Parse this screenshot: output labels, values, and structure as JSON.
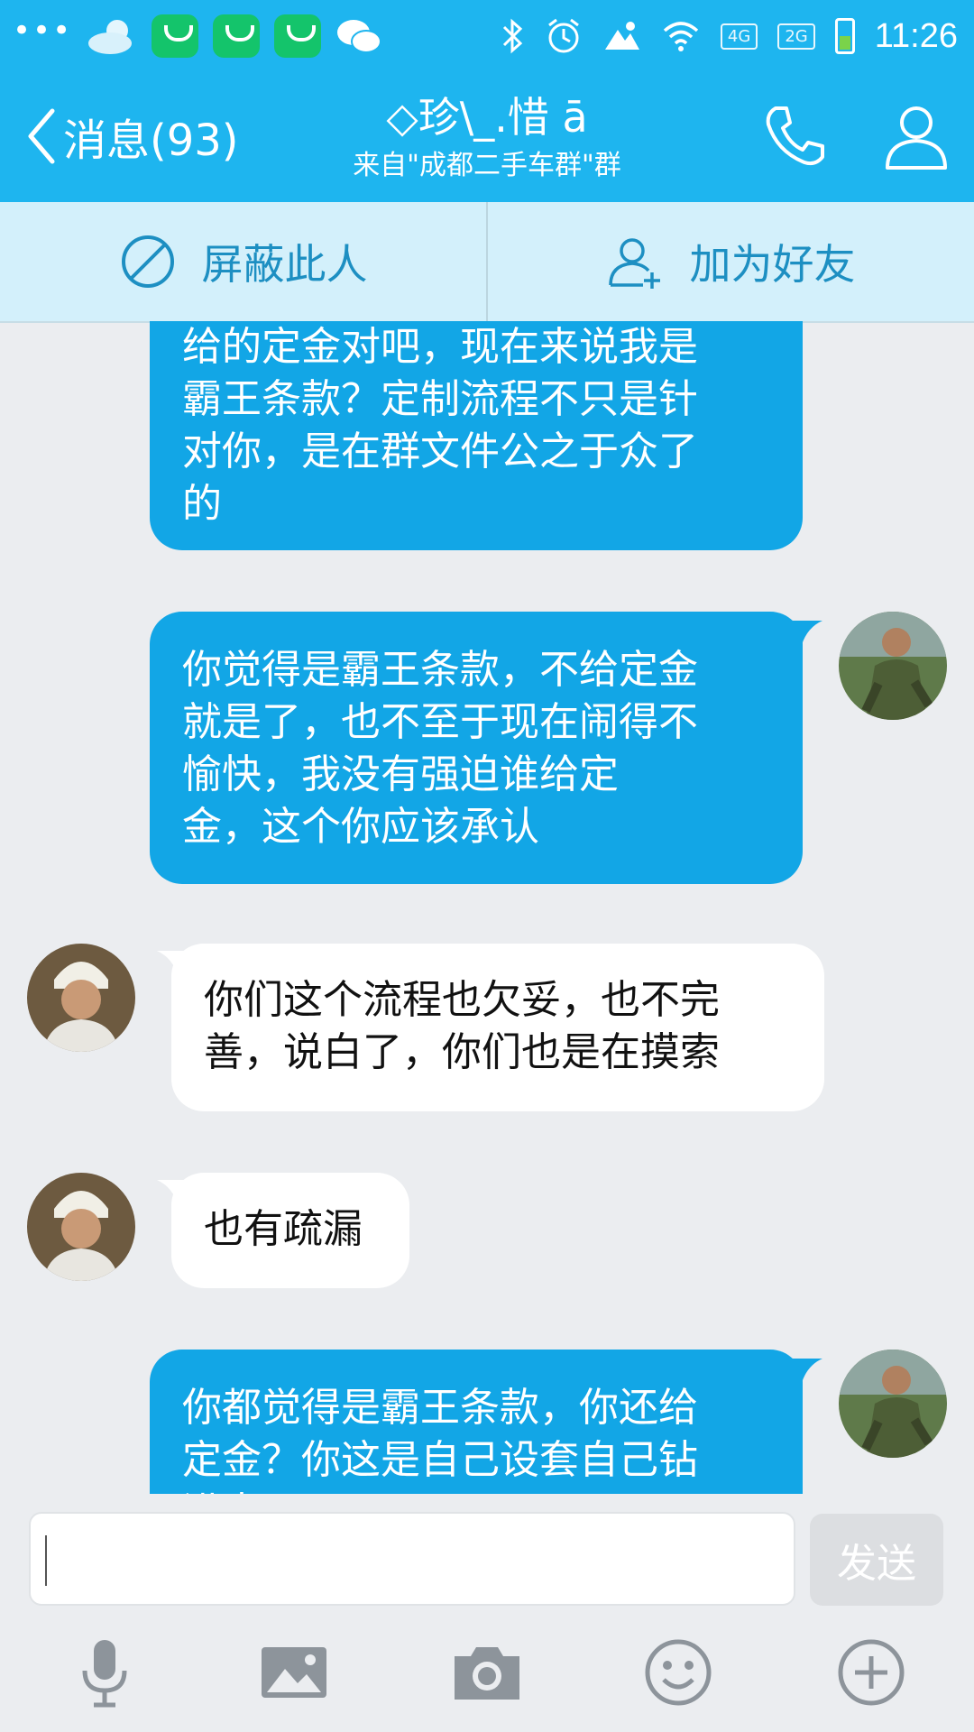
{
  "status_bar": {
    "time": "11:26",
    "network_4g": "4G",
    "network_2g": "2G"
  },
  "header": {
    "back_label": "消息(93)",
    "contact_name": "◇珍\\_.惜 ā",
    "contact_source": "来自\"成都二手车群\"群"
  },
  "actions": {
    "block_label": "屏蔽此人",
    "add_friend_label": "加为好友"
  },
  "messages": [
    {
      "direction": "out",
      "lines": [
        "给的定金对吧，现在来说我是",
        "霸王条款？定制流程不只是针",
        "对你，是在群文件公之于众了",
        "的"
      ]
    },
    {
      "direction": "out",
      "lines": [
        "你觉得是霸王条款，不给定金",
        "就是了，也不至于现在闹得不",
        "愉快，我没有强迫谁给定",
        "金，这个你应该承认"
      ]
    },
    {
      "direction": "in",
      "lines": [
        "你们这个流程也欠妥，也不完",
        "善，说白了，你们也是在摸索"
      ]
    },
    {
      "direction": "in",
      "lines": [
        "也有疏漏"
      ]
    },
    {
      "direction": "out",
      "lines": [
        "你都觉得是霸王条款，你还给",
        "定金？你这是自己设套自己钻",
        "进去"
      ]
    }
  ],
  "input": {
    "text": "",
    "send_label": "发送"
  },
  "colors": {
    "brand": "#1eb5ef",
    "outgoing_bubble": "#12a6e6",
    "incoming_bubble": "#ffffff",
    "action_bar": "#d3f0fb"
  },
  "icons": {
    "toolbar": [
      "microphone-icon",
      "image-icon",
      "camera-icon",
      "emoji-icon",
      "plus-icon"
    ]
  }
}
